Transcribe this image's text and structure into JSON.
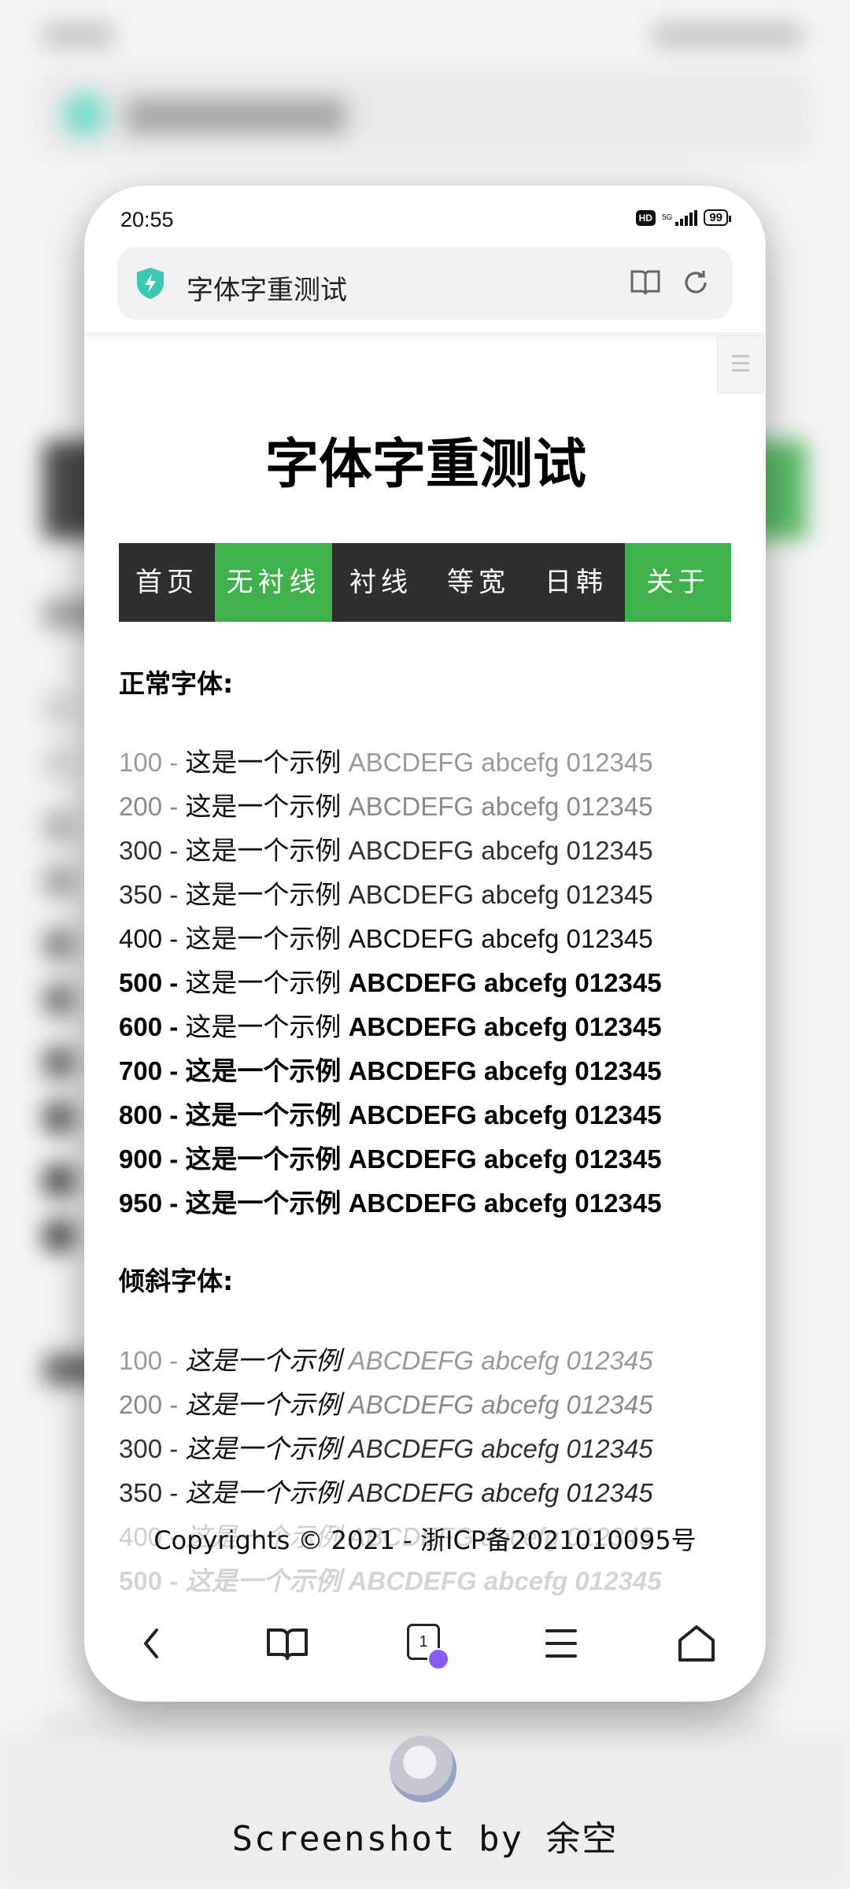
{
  "status_bar": {
    "time": "20:55",
    "hd": "HD",
    "network": "5G",
    "battery": "99"
  },
  "address_bar": {
    "title": "字体字重测试"
  },
  "page": {
    "title": "字体字重测试",
    "nav": [
      {
        "label": "首页",
        "active": false
      },
      {
        "label": "无衬线",
        "active": true
      },
      {
        "label": "衬线",
        "active": false
      },
      {
        "label": "等宽",
        "active": false
      },
      {
        "label": "日韩",
        "active": false
      },
      {
        "label": "关于",
        "active": true
      }
    ],
    "normal_heading": "正常字体:",
    "italic_heading": "倾斜字体:",
    "normal_rows": [
      {
        "weight": "100",
        "text_zh": "这是一个示例",
        "text_en": "ABCDEFG abcefg 012345"
      },
      {
        "weight": "200",
        "text_zh": "这是一个示例",
        "text_en": "ABCDEFG abcefg 012345"
      },
      {
        "weight": "300",
        "text_zh": "这是一个示例",
        "text_en": "ABCDEFG abcefg 012345"
      },
      {
        "weight": "350",
        "text_zh": "这是一个示例",
        "text_en": "ABCDEFG abcefg 012345"
      },
      {
        "weight": "400",
        "text_zh": "这是一个示例",
        "text_en": "ABCDEFG abcefg 012345"
      },
      {
        "weight": "500",
        "text_zh": "这是一个示例",
        "text_en": "ABCDEFG abcefg 012345"
      },
      {
        "weight": "600",
        "text_zh": "这是一个示例",
        "text_en": "ABCDEFG abcefg 012345"
      },
      {
        "weight": "700",
        "text_zh": "这是一个示例",
        "text_en": "ABCDEFG abcefg 012345"
      },
      {
        "weight": "800",
        "text_zh": "这是一个示例",
        "text_en": "ABCDEFG abcefg 012345"
      },
      {
        "weight": "900",
        "text_zh": "这是一个示例",
        "text_en": "ABCDEFG abcefg 012345"
      },
      {
        "weight": "950",
        "text_zh": "这是一个示例",
        "text_en": "ABCDEFG abcefg 012345"
      }
    ],
    "italic_rows": [
      {
        "weight": "100",
        "text_zh": "这是一个示例",
        "text_en": "ABCDEFG abcefg 012345"
      },
      {
        "weight": "200",
        "text_zh": "这是一个示例",
        "text_en": "ABCDEFG abcefg 012345"
      },
      {
        "weight": "300",
        "text_zh": "这是一个示例",
        "text_en": "ABCDEFG abcefg 012345"
      },
      {
        "weight": "350",
        "text_zh": "这是一个示例",
        "text_en": "ABCDEFG abcefg 012345"
      },
      {
        "weight": "400",
        "text_zh": "这是一个示例",
        "text_en": "ABCDEFG abcefg 012345"
      },
      {
        "weight": "500",
        "text_zh": "这是一个示例",
        "text_en": "ABCDEFG abcefg 012345"
      }
    ],
    "footer": "Copyrights © 2021 - 浙ICP备2021010095号"
  },
  "bottom_nav": [
    {
      "icon": "back-icon"
    },
    {
      "icon": "bookmarks-icon"
    },
    {
      "icon": "tabs-icon",
      "count": "1"
    },
    {
      "icon": "menu-icon"
    },
    {
      "icon": "home-icon"
    }
  ],
  "watermark": "Screenshot by 余空",
  "colors": {
    "nav_bg": "#2f2f2f",
    "nav_active": "#41b14d",
    "shield": "#3cc8b4"
  }
}
